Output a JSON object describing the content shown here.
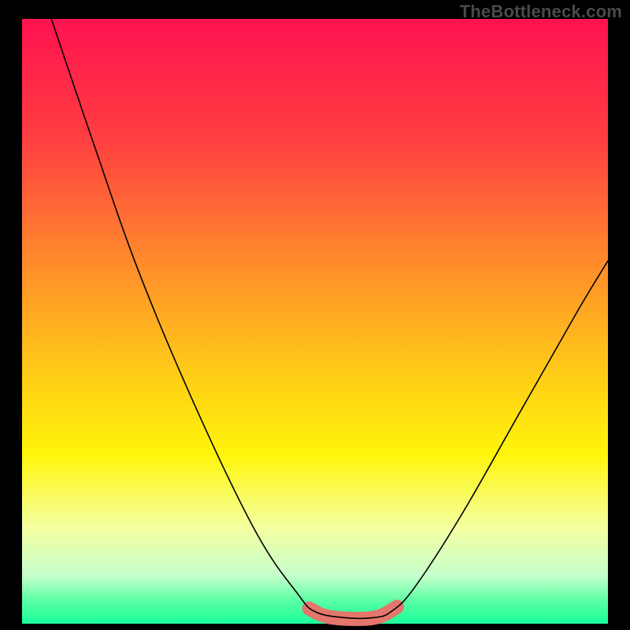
{
  "watermark": "TheBottleneck.com",
  "chart_data": {
    "type": "line",
    "title": "",
    "xlabel": "",
    "ylabel": "",
    "xlim": [
      0,
      100
    ],
    "ylim": [
      0,
      100
    ],
    "grid": false,
    "legend": false,
    "background": {
      "type": "vertical-gradient",
      "stops": [
        {
          "pos": 0.0,
          "color": "#ff1250"
        },
        {
          "pos": 0.2,
          "color": "#ff3f40"
        },
        {
          "pos": 0.4,
          "color": "#ff8a2c"
        },
        {
          "pos": 0.58,
          "color": "#ffca18"
        },
        {
          "pos": 0.72,
          "color": "#fff50a"
        },
        {
          "pos": 0.84,
          "color": "#f4ffa0"
        },
        {
          "pos": 0.92,
          "color": "#c6ffcb"
        },
        {
          "pos": 0.965,
          "color": "#55ffa4"
        },
        {
          "pos": 1.0,
          "color": "#19ff9a"
        }
      ]
    },
    "series": [
      {
        "name": "bottleneck-curve",
        "color": "#000000",
        "width": 1.6,
        "points": [
          {
            "x": 5,
            "y": 100
          },
          {
            "x": 12,
            "y": 80
          },
          {
            "x": 20,
            "y": 58
          },
          {
            "x": 30,
            "y": 35
          },
          {
            "x": 40,
            "y": 15
          },
          {
            "x": 47,
            "y": 5
          },
          {
            "x": 50,
            "y": 2
          },
          {
            "x": 55,
            "y": 1
          },
          {
            "x": 60,
            "y": 1
          },
          {
            "x": 63,
            "y": 2
          },
          {
            "x": 67,
            "y": 6
          },
          {
            "x": 75,
            "y": 18
          },
          {
            "x": 85,
            "y": 35
          },
          {
            "x": 95,
            "y": 52
          },
          {
            "x": 100,
            "y": 60
          }
        ]
      },
      {
        "name": "highlight-band",
        "color": "#e4766d",
        "width": 18,
        "points": [
          {
            "x": 49,
            "y": 2.5
          },
          {
            "x": 52,
            "y": 1.2
          },
          {
            "x": 57,
            "y": 0.8
          },
          {
            "x": 61,
            "y": 1.2
          },
          {
            "x": 64,
            "y": 2.8
          }
        ]
      }
    ]
  }
}
